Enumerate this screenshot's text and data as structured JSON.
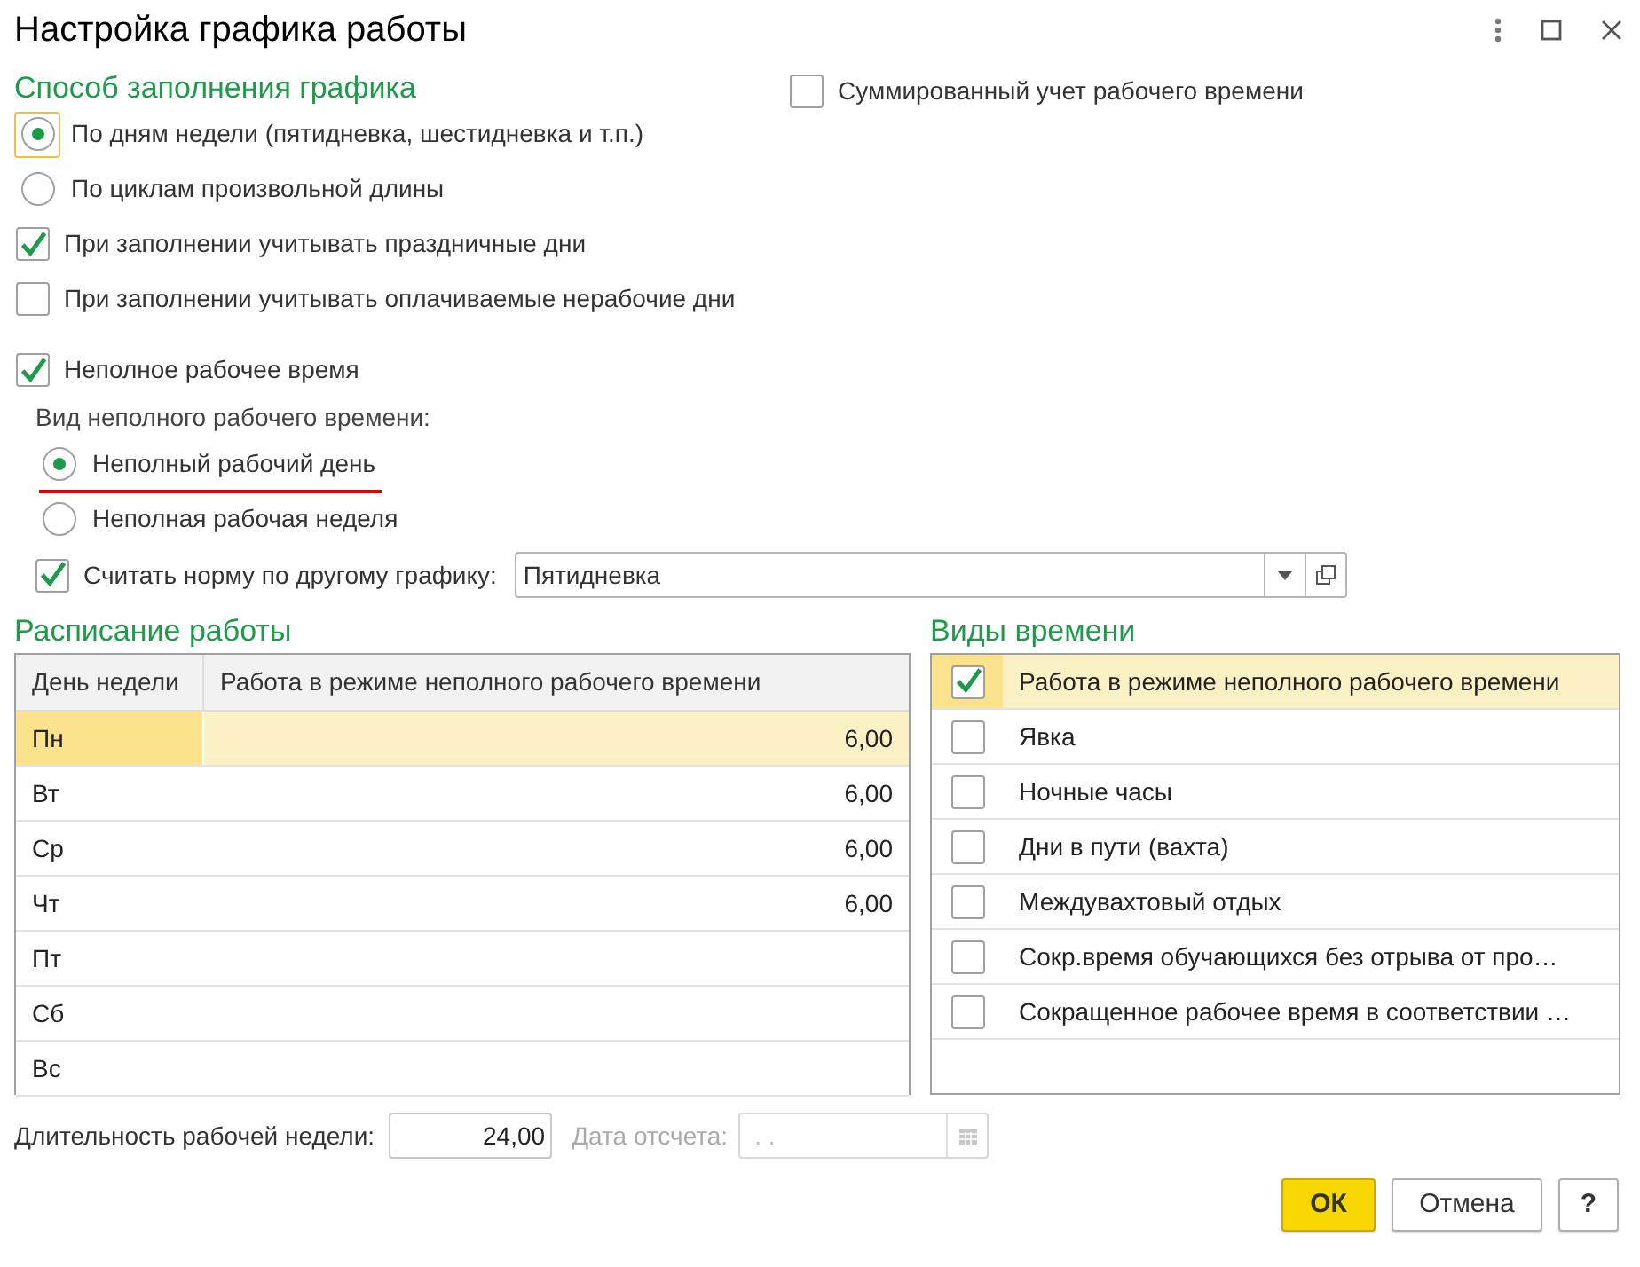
{
  "title": "Настройка графика работы",
  "fill_section": {
    "heading": "Способ заполнения графика",
    "modes": [
      {
        "label": "По дням недели (пятидневка, шестидневка и т.п.)",
        "selected": true,
        "focused": true
      },
      {
        "label": "По циклам произвольной длины",
        "selected": false,
        "focused": false
      }
    ],
    "options": [
      {
        "label": "При заполнении учитывать праздничные дни",
        "checked": true
      },
      {
        "label": "При заполнении учитывать оплачиваемые нерабочие дни",
        "checked": false
      }
    ]
  },
  "summed": {
    "label": "Суммированный учет рабочего времени",
    "checked": false
  },
  "part_time": {
    "label": "Неполное рабочее время",
    "checked": true,
    "type_label": "Вид неполного рабочего времени:",
    "types": [
      {
        "label": "Неполный рабочий день",
        "selected": true,
        "underlined": true
      },
      {
        "label": "Неполная рабочая неделя",
        "selected": false,
        "underlined": false
      }
    ],
    "other_norm": {
      "label": "Считать норму по другому графику:",
      "checked": true,
      "value": "Пятидневка"
    }
  },
  "schedule": {
    "heading": "Расписание работы",
    "columns": [
      "День недели",
      "Работа в режиме неполного рабочего времени"
    ],
    "rows": [
      {
        "day": "Пн",
        "hours": "6,00",
        "selected": true
      },
      {
        "day": "Вт",
        "hours": "6,00",
        "selected": false
      },
      {
        "day": "Ср",
        "hours": "6,00",
        "selected": false
      },
      {
        "day": "Чт",
        "hours": "6,00",
        "selected": false
      },
      {
        "day": "Пт",
        "selected": false
      },
      {
        "day": "Сб",
        "selected": false
      },
      {
        "day": "Вс",
        "selected": false
      }
    ]
  },
  "time_kinds": {
    "heading": "Виды времени",
    "rows": [
      {
        "label": "Работа в режиме неполного рабочего времени",
        "checked": true,
        "selected": true
      },
      {
        "label": "Явка",
        "checked": false,
        "selected": false
      },
      {
        "label": "Ночные часы",
        "checked": false,
        "selected": false
      },
      {
        "label": "Дни в пути (вахта)",
        "checked": false,
        "selected": false
      },
      {
        "label": "Междувахтовый отдых",
        "checked": false,
        "selected": false
      },
      {
        "label": "Сокр.время обучающихся без отрыва от про…",
        "checked": false,
        "selected": false
      },
      {
        "label": "Сокращенное рабочее время в соответствии …",
        "checked": false,
        "selected": false
      }
    ]
  },
  "footer": {
    "week_length": {
      "label": "Длительность рабочей недели:",
      "value": "24,00"
    },
    "start_date": {
      "label": "Дата отсчета:",
      "placeholder": ". .",
      "disabled": true
    }
  },
  "buttons": [
    {
      "label": "ОК",
      "kind": "primary"
    },
    {
      "label": "Отмена",
      "kind": "default"
    },
    {
      "label": "?",
      "kind": "help"
    }
  ]
}
